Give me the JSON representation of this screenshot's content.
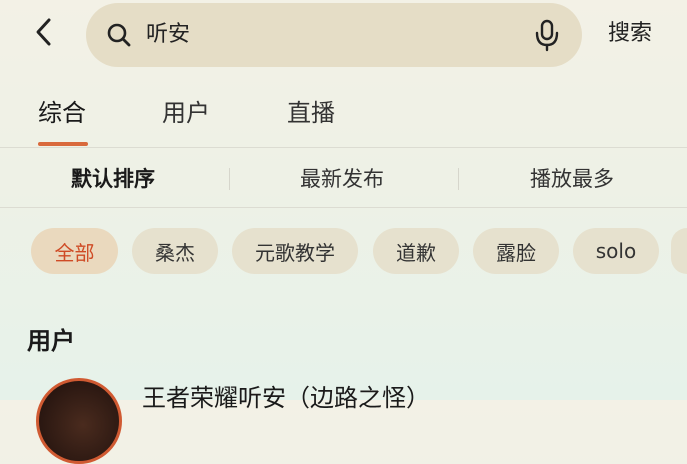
{
  "search": {
    "query": "听安",
    "submit_label": "搜索"
  },
  "tabs": [
    {
      "label": "综合",
      "active": true
    },
    {
      "label": "用户",
      "active": false
    },
    {
      "label": "直播",
      "active": false
    }
  ],
  "sort_options": [
    {
      "label": "默认排序",
      "active": true
    },
    {
      "label": "最新发布",
      "active": false
    },
    {
      "label": "播放最多",
      "active": false
    }
  ],
  "chips": [
    {
      "label": "全部",
      "active": true
    },
    {
      "label": "桑杰",
      "active": false
    },
    {
      "label": "元歌教学",
      "active": false
    },
    {
      "label": "道歉",
      "active": false
    },
    {
      "label": "露脸",
      "active": false
    },
    {
      "label": "solo",
      "active": false
    }
  ],
  "users_section": {
    "title": "用户",
    "first_user_name": "王者荣耀听安（边路之怪）"
  },
  "colors": {
    "accent": "#d9693c",
    "chip_active_text": "#cf4b25",
    "search_bg": "#e5ddc6"
  },
  "icons": {
    "back": "chevron-left-icon",
    "search": "search-icon",
    "mic": "microphone-icon"
  }
}
